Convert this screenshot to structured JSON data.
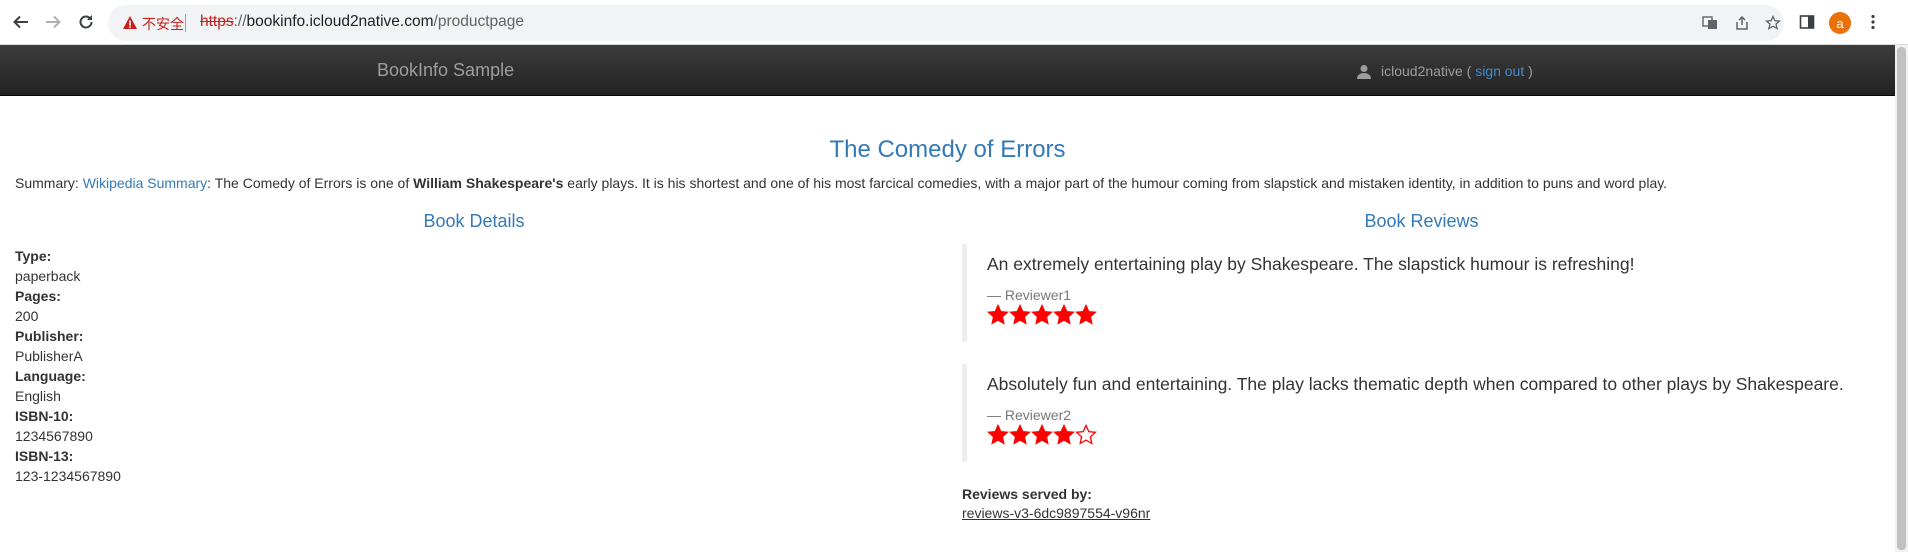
{
  "browser": {
    "url_security_label": "不安全",
    "url_scheme": "https",
    "url_separator": "://",
    "url_host": "bookinfo.icloud2native.com",
    "url_path": "/productpage",
    "profile_initial": "a",
    "accent_color": "#e8710a"
  },
  "navbar": {
    "brand": "BookInfo Sample",
    "username": "icloud2native",
    "open_paren": "(",
    "sign_out": "sign out",
    "close_paren": ")"
  },
  "product": {
    "title": "The Comedy of Errors",
    "summary_label": "Summary:",
    "summary_link": "Wikipedia Summary",
    "summary_pre": ": The Comedy of Errors is one of",
    "summary_bold": "William Shakespeare's",
    "summary_post": "early plays. It is his shortest and one of his most farcical comedies, with a major part of the humour coming from slapstick and mistaken identity, in addition to puns and word play."
  },
  "details": {
    "heading": "Book Details",
    "fields": [
      {
        "label": "Type:",
        "value": "paperback"
      },
      {
        "label": "Pages:",
        "value": "200"
      },
      {
        "label": "Publisher:",
        "value": "PublisherA"
      },
      {
        "label": "Language:",
        "value": "English"
      },
      {
        "label": "ISBN-10:",
        "value": "1234567890"
      },
      {
        "label": "ISBN-13:",
        "value": "123-1234567890"
      }
    ]
  },
  "reviews": {
    "heading": "Book Reviews",
    "star_color": "#ff0000",
    "items": [
      {
        "text": "An extremely entertaining play by Shakespeare. The slapstick humour is refreshing!",
        "reviewer": "— Reviewer1",
        "rating": 5,
        "max": 5
      },
      {
        "text": "Absolutely fun and entertaining. The play lacks thematic depth when compared to other plays by Shakespeare.",
        "reviewer": "— Reviewer2",
        "rating": 4,
        "max": 5
      }
    ],
    "served_label": "Reviews served by:",
    "served_pod": "reviews-v3-6dc9897554-v96nr"
  }
}
